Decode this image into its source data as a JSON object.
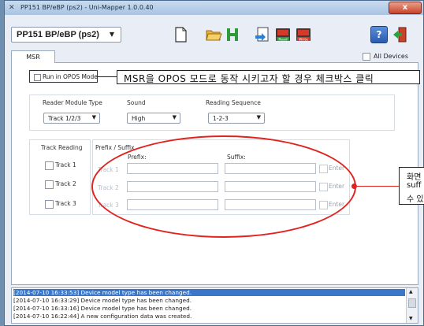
{
  "window": {
    "title": "PP151 BP/eBP (ps2) - Uni-Mapper 1.0.0.40",
    "close_label": "x"
  },
  "toolbar": {
    "device": "PP151 BP/eBP (ps2)",
    "read_label": "Read",
    "write_label": "Write",
    "help_label": "?"
  },
  "tabs": [
    {
      "label": "MSR"
    }
  ],
  "all_devices_label": "All Devices",
  "opos": {
    "label": "Run in OPOS Mode",
    "callout": "MSR을 OPOS 모드로 동작 시키고자 할 경우 체크박스 클릭"
  },
  "reader": {
    "label": "Reader Module Type",
    "value": "Track 1/2/3"
  },
  "sound": {
    "label": "Sound",
    "value": "High"
  },
  "sequence": {
    "label": "Reading Sequence",
    "value": "1-2-3"
  },
  "track_reading": {
    "label": "Track Reading",
    "tracks": [
      "Track 1",
      "Track 2",
      "Track 3"
    ]
  },
  "prefix_suffix": {
    "label": "Prefix / Suffix",
    "prefix_label": "Prefix:",
    "suffix_label": "Suffix:",
    "ghost_tracks": [
      "Track 1",
      "Track 2",
      "Track 3"
    ],
    "enter_label": "Enter"
  },
  "callout2": {
    "lines": [
      "화면",
      "suff",
      "수 있"
    ]
  },
  "log": [
    "[2014-07-10 16:33:53] Device model type has been changed.",
    "[2014-07-10 16:33:29] Device model type has been changed.",
    "[2014-07-10 16:33:16] Device model type has been changed.",
    "[2014-07-10 16:22:44] A new configuration data was created."
  ],
  "colors": {
    "accent": "#e0231f",
    "selection": "#3b76c8"
  }
}
